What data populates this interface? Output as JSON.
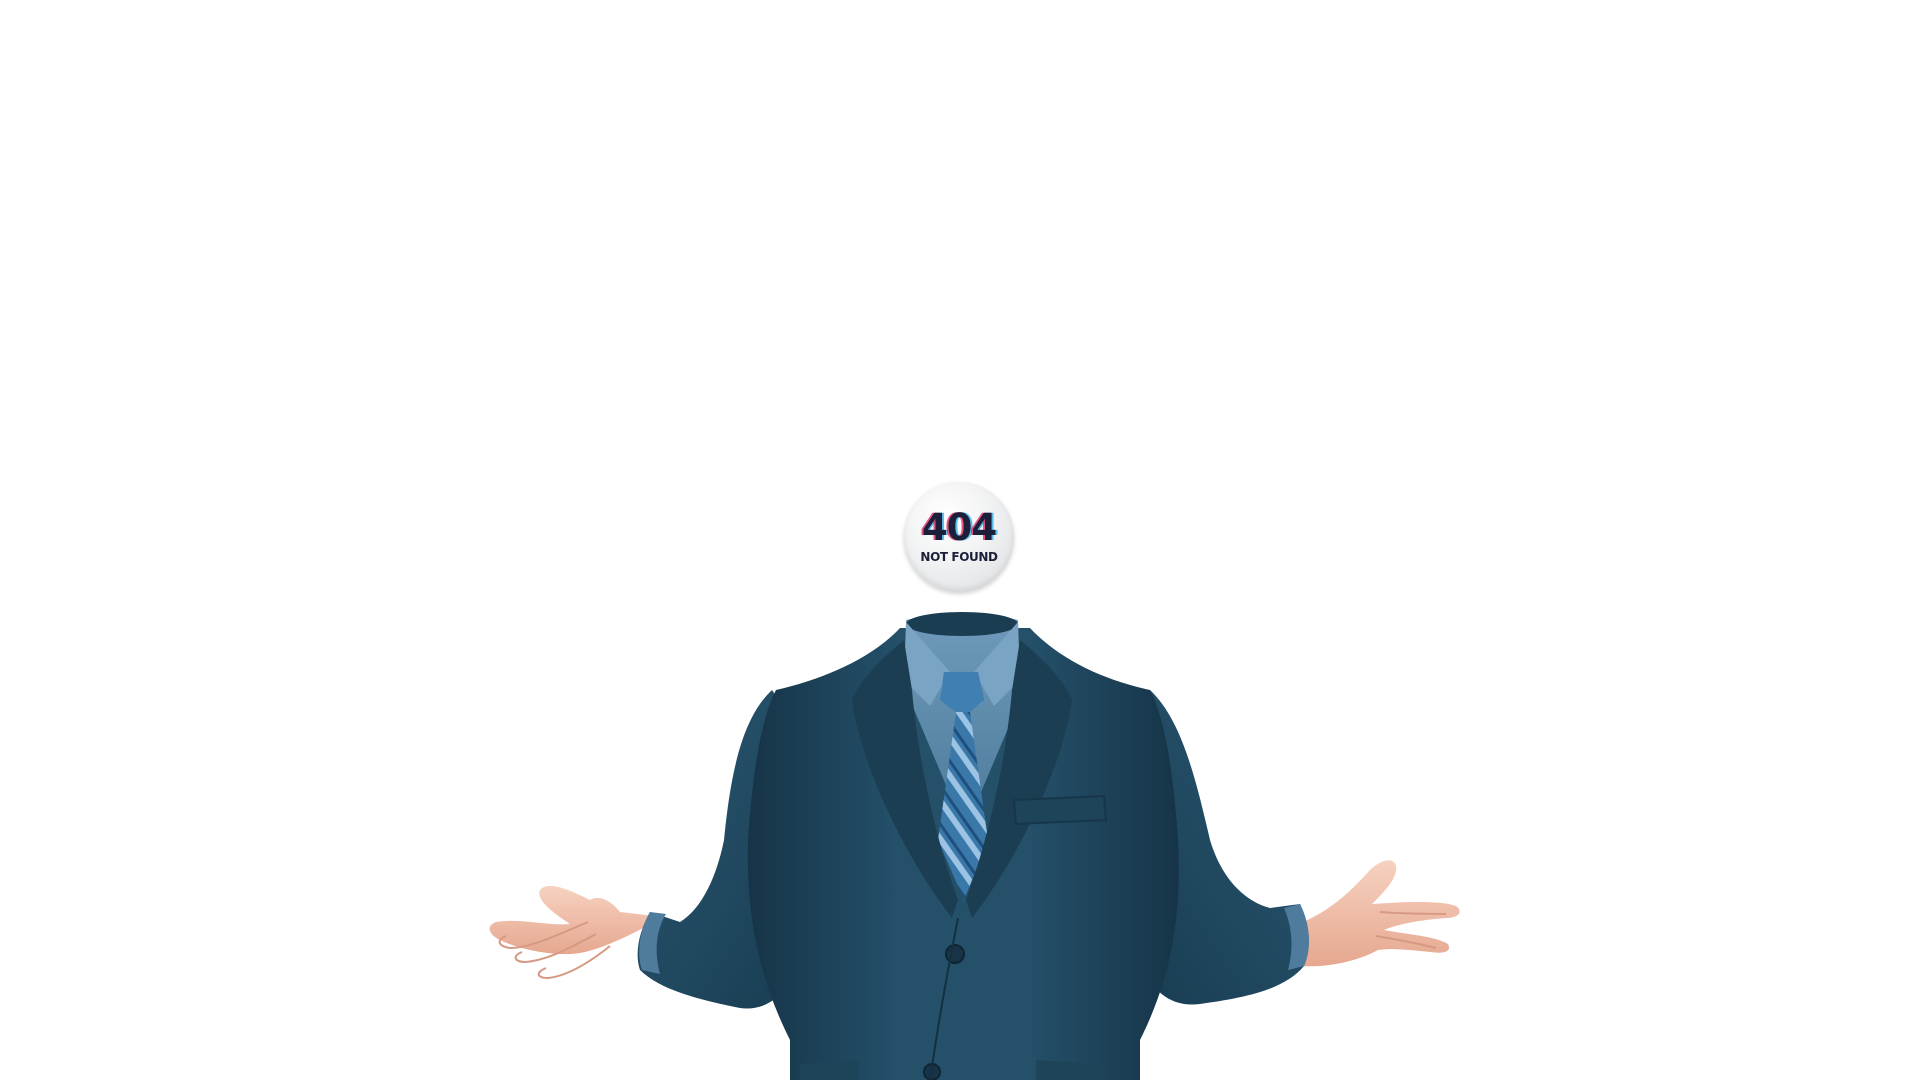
{
  "badge": {
    "code": "404",
    "text": "NOT FOUND"
  },
  "illustration": {
    "subject": "headless-businessman-shrug",
    "colors": {
      "suit": "#1f4458",
      "shirt": "#5b87a6",
      "tie": "#3a78aa",
      "skin": "#f2c9b4",
      "background": "#ffffff",
      "badge_text": "#1c1f3a",
      "glitch_red": "#dc1e5a",
      "glitch_blue": "#28aae6"
    }
  }
}
